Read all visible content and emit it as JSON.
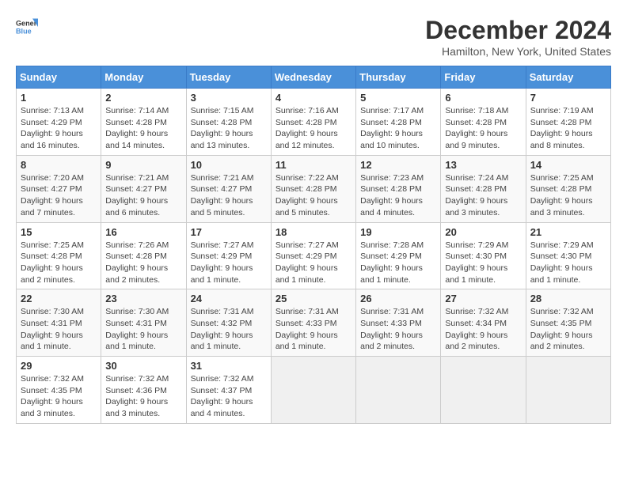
{
  "header": {
    "logo_general": "General",
    "logo_blue": "Blue",
    "title": "December 2024",
    "subtitle": "Hamilton, New York, United States"
  },
  "calendar": {
    "days_of_week": [
      "Sunday",
      "Monday",
      "Tuesday",
      "Wednesday",
      "Thursday",
      "Friday",
      "Saturday"
    ],
    "weeks": [
      [
        null,
        {
          "day": "2",
          "sunrise": "Sunrise: 7:14 AM",
          "sunset": "Sunset: 4:28 PM",
          "daylight": "Daylight: 9 hours and 14 minutes."
        },
        {
          "day": "3",
          "sunrise": "Sunrise: 7:15 AM",
          "sunset": "Sunset: 4:28 PM",
          "daylight": "Daylight: 9 hours and 13 minutes."
        },
        {
          "day": "4",
          "sunrise": "Sunrise: 7:16 AM",
          "sunset": "Sunset: 4:28 PM",
          "daylight": "Daylight: 9 hours and 12 minutes."
        },
        {
          "day": "5",
          "sunrise": "Sunrise: 7:17 AM",
          "sunset": "Sunset: 4:28 PM",
          "daylight": "Daylight: 9 hours and 10 minutes."
        },
        {
          "day": "6",
          "sunrise": "Sunrise: 7:18 AM",
          "sunset": "Sunset: 4:28 PM",
          "daylight": "Daylight: 9 hours and 9 minutes."
        },
        {
          "day": "7",
          "sunrise": "Sunrise: 7:19 AM",
          "sunset": "Sunset: 4:28 PM",
          "daylight": "Daylight: 9 hours and 8 minutes."
        }
      ],
      [
        {
          "day": "1",
          "sunrise": "Sunrise: 7:13 AM",
          "sunset": "Sunset: 4:29 PM",
          "daylight": "Daylight: 9 hours and 16 minutes."
        },
        {
          "day": "9",
          "sunrise": "Sunrise: 7:21 AM",
          "sunset": "Sunset: 4:27 PM",
          "daylight": "Daylight: 9 hours and 6 minutes."
        },
        {
          "day": "10",
          "sunrise": "Sunrise: 7:21 AM",
          "sunset": "Sunset: 4:27 PM",
          "daylight": "Daylight: 9 hours and 5 minutes."
        },
        {
          "day": "11",
          "sunrise": "Sunrise: 7:22 AM",
          "sunset": "Sunset: 4:28 PM",
          "daylight": "Daylight: 9 hours and 5 minutes."
        },
        {
          "day": "12",
          "sunrise": "Sunrise: 7:23 AM",
          "sunset": "Sunset: 4:28 PM",
          "daylight": "Daylight: 9 hours and 4 minutes."
        },
        {
          "day": "13",
          "sunrise": "Sunrise: 7:24 AM",
          "sunset": "Sunset: 4:28 PM",
          "daylight": "Daylight: 9 hours and 3 minutes."
        },
        {
          "day": "14",
          "sunrise": "Sunrise: 7:25 AM",
          "sunset": "Sunset: 4:28 PM",
          "daylight": "Daylight: 9 hours and 3 minutes."
        }
      ],
      [
        {
          "day": "8",
          "sunrise": "Sunrise: 7:20 AM",
          "sunset": "Sunset: 4:27 PM",
          "daylight": "Daylight: 9 hours and 7 minutes."
        },
        {
          "day": "16",
          "sunrise": "Sunrise: 7:26 AM",
          "sunset": "Sunset: 4:28 PM",
          "daylight": "Daylight: 9 hours and 2 minutes."
        },
        {
          "day": "17",
          "sunrise": "Sunrise: 7:27 AM",
          "sunset": "Sunset: 4:29 PM",
          "daylight": "Daylight: 9 hours and 1 minute."
        },
        {
          "day": "18",
          "sunrise": "Sunrise: 7:27 AM",
          "sunset": "Sunset: 4:29 PM",
          "daylight": "Daylight: 9 hours and 1 minute."
        },
        {
          "day": "19",
          "sunrise": "Sunrise: 7:28 AM",
          "sunset": "Sunset: 4:29 PM",
          "daylight": "Daylight: 9 hours and 1 minute."
        },
        {
          "day": "20",
          "sunrise": "Sunrise: 7:29 AM",
          "sunset": "Sunset: 4:30 PM",
          "daylight": "Daylight: 9 hours and 1 minute."
        },
        {
          "day": "21",
          "sunrise": "Sunrise: 7:29 AM",
          "sunset": "Sunset: 4:30 PM",
          "daylight": "Daylight: 9 hours and 1 minute."
        }
      ],
      [
        {
          "day": "15",
          "sunrise": "Sunrise: 7:25 AM",
          "sunset": "Sunset: 4:28 PM",
          "daylight": "Daylight: 9 hours and 2 minutes."
        },
        {
          "day": "23",
          "sunrise": "Sunrise: 7:30 AM",
          "sunset": "Sunset: 4:31 PM",
          "daylight": "Daylight: 9 hours and 1 minute."
        },
        {
          "day": "24",
          "sunrise": "Sunrise: 7:31 AM",
          "sunset": "Sunset: 4:32 PM",
          "daylight": "Daylight: 9 hours and 1 minute."
        },
        {
          "day": "25",
          "sunrise": "Sunrise: 7:31 AM",
          "sunset": "Sunset: 4:33 PM",
          "daylight": "Daylight: 9 hours and 1 minute."
        },
        {
          "day": "26",
          "sunrise": "Sunrise: 7:31 AM",
          "sunset": "Sunset: 4:33 PM",
          "daylight": "Daylight: 9 hours and 2 minutes."
        },
        {
          "day": "27",
          "sunrise": "Sunrise: 7:32 AM",
          "sunset": "Sunset: 4:34 PM",
          "daylight": "Daylight: 9 hours and 2 minutes."
        },
        {
          "day": "28",
          "sunrise": "Sunrise: 7:32 AM",
          "sunset": "Sunset: 4:35 PM",
          "daylight": "Daylight: 9 hours and 2 minutes."
        }
      ],
      [
        {
          "day": "22",
          "sunrise": "Sunrise: 7:30 AM",
          "sunset": "Sunset: 4:31 PM",
          "daylight": "Daylight: 9 hours and 1 minute."
        },
        {
          "day": "30",
          "sunrise": "Sunrise: 7:32 AM",
          "sunset": "Sunset: 4:36 PM",
          "daylight": "Daylight: 9 hours and 3 minutes."
        },
        {
          "day": "31",
          "sunrise": "Sunrise: 7:32 AM",
          "sunset": "Sunset: 4:37 PM",
          "daylight": "Daylight: 9 hours and 4 minutes."
        },
        null,
        null,
        null,
        null
      ],
      [
        {
          "day": "29",
          "sunrise": "Sunrise: 7:32 AM",
          "sunset": "Sunset: 4:35 PM",
          "daylight": "Daylight: 9 hours and 3 minutes."
        }
      ]
    ]
  }
}
